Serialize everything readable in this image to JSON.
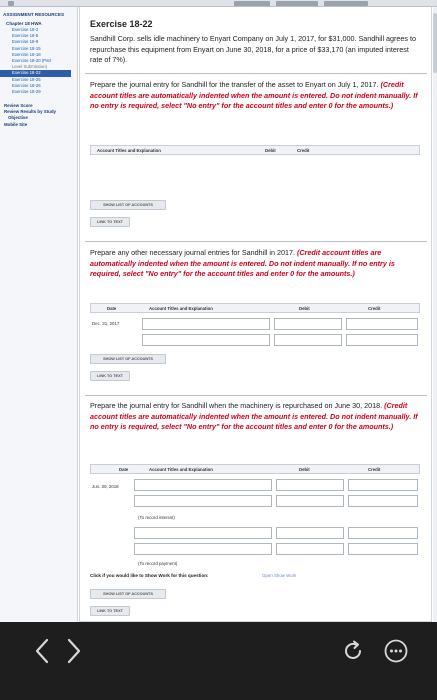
{
  "sidebar": {
    "header": "ASSIGNMENT RESOURCES",
    "chapter": "Chapter 18 HWA",
    "items": [
      {
        "label": "Exercise 18-2",
        "state": "link"
      },
      {
        "label": "Exercise 18-5",
        "state": "link"
      },
      {
        "label": "Exercise 18-9",
        "state": "link"
      },
      {
        "label": "Exercise 18-15",
        "state": "link"
      },
      {
        "label": "Exercise 18-18",
        "state": "link"
      },
      {
        "label": "Exercise 18-20 (Part",
        "state": "link"
      },
      {
        "label": "Level Submission)",
        "state": "gray"
      },
      {
        "label": "Exercise 18-22",
        "state": "active"
      },
      {
        "label": "Exercise 18-25",
        "state": "link"
      },
      {
        "label": "Exercise 18-26",
        "state": "link"
      },
      {
        "label": "Exercise 18-29",
        "state": "link"
      }
    ],
    "section1": "Review Score",
    "section2a": "Review Results by Study",
    "section2b": "Objective",
    "section3": "Mobile Site"
  },
  "exercise": {
    "title": "Exercise 18-22",
    "intro": "Sandhill Corp. sells idle machinery to Enyart Company on July 1, 2017, for $31,000. Sandhill agrees to repurchase this equipment from Enyart on June 30, 2018, for a price of $33,170 (an imputed interest rate of 7%)."
  },
  "parts": [
    {
      "prompt": "Prepare the journal entry for Sandhill for the transfer of the asset to Enyart on July 1, 2017.",
      "instruction": "(Credit account titles are automatically indented when the amount is entered. Do not indent manually. If no entry is required, select \"No entry\" for the account titles and enter 0 for the amounts.)",
      "headers": {
        "account": "Account Titles and Explanation",
        "debit": "Debit",
        "credit": "Credit"
      },
      "accounts_button": "SHOW LIST OF ACCOUNTS",
      "link_button": "LINK TO TEXT"
    },
    {
      "prompt": "Prepare any other necessary journal entries for Sandhill in 2017.",
      "instruction": "(Credit account titles are automatically indented when the amount is entered. Do not indent manually. If no entry is required, select \"No entry\" for the account titles and enter 0 for the amounts.)",
      "headers": {
        "date": "Date",
        "account": "Account Titles and Explanation",
        "debit": "Debit",
        "credit": "Credit"
      },
      "date_value": "Dec. 31, 2017",
      "accounts_button": "SHOW LIST OF ACCOUNTS",
      "link_button": "LINK TO TEXT"
    },
    {
      "prompt": "Prepare the journal entry for Sandhill when the machinery is repurchased on June 30, 2018.",
      "instruction": "(Credit account titles are automatically indented when the amount is entered. Do not indent manually. If no entry is required, select \"No entry\" for the account titles and enter 0 for the amounts.)",
      "headers": {
        "date": "Date",
        "account": "Account Titles and Explanation",
        "debit": "Debit",
        "credit": "Credit"
      },
      "date_value": "Jun. 30, 2018",
      "row_label_1": "(To record interest)",
      "row_label_2": "(To record payment)",
      "show_work_text": "Click if you would like to Show Work for this question:",
      "show_work_link": "Open Show Work",
      "accounts_button": "SHOW LIST OF ACCOUNTS",
      "link_button": "LINK TO TEXT"
    }
  ]
}
